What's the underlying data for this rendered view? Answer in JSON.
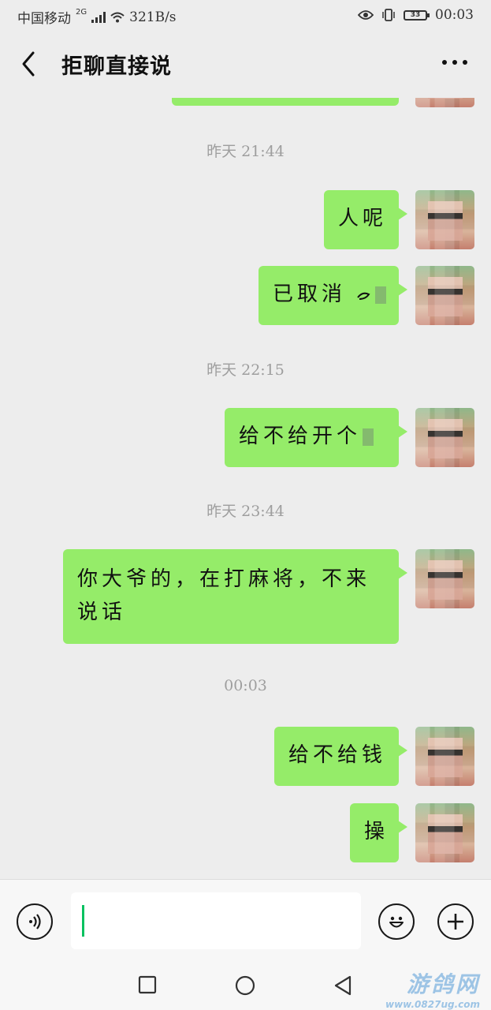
{
  "status_bar": {
    "carrier": "中国移动",
    "network": "2G",
    "speed": "321B/s",
    "time": "00:03",
    "battery": "33"
  },
  "header": {
    "title": "拒聊直接说"
  },
  "messages": [
    {
      "type": "time",
      "text": "昨天 21:44"
    },
    {
      "type": "sent",
      "text": "人呢"
    },
    {
      "type": "sent",
      "text": "已取消 "
    },
    {
      "type": "time",
      "text": "昨天 22:15"
    },
    {
      "type": "sent",
      "text": "给不给开个"
    },
    {
      "type": "time",
      "text": "昨天 23:44"
    },
    {
      "type": "sent",
      "text": "你大爷的，在打麻将，不来说话"
    },
    {
      "type": "time",
      "text": "00:03"
    },
    {
      "type": "sent",
      "text": "给不给钱"
    },
    {
      "type": "sent",
      "text": "操"
    }
  ],
  "input": {
    "value": "",
    "placeholder": ""
  },
  "watermark": {
    "line1": "游鸽网",
    "line2": "www.0827ug.com"
  },
  "icons": {
    "back": "back-arrow-icon",
    "more": "more-icon",
    "voice": "voice-icon",
    "emoji": "emoji-icon",
    "plus": "plus-icon"
  },
  "colors": {
    "bubble_sent": "#95ec69",
    "background": "#ededed",
    "caret": "#07c160"
  }
}
